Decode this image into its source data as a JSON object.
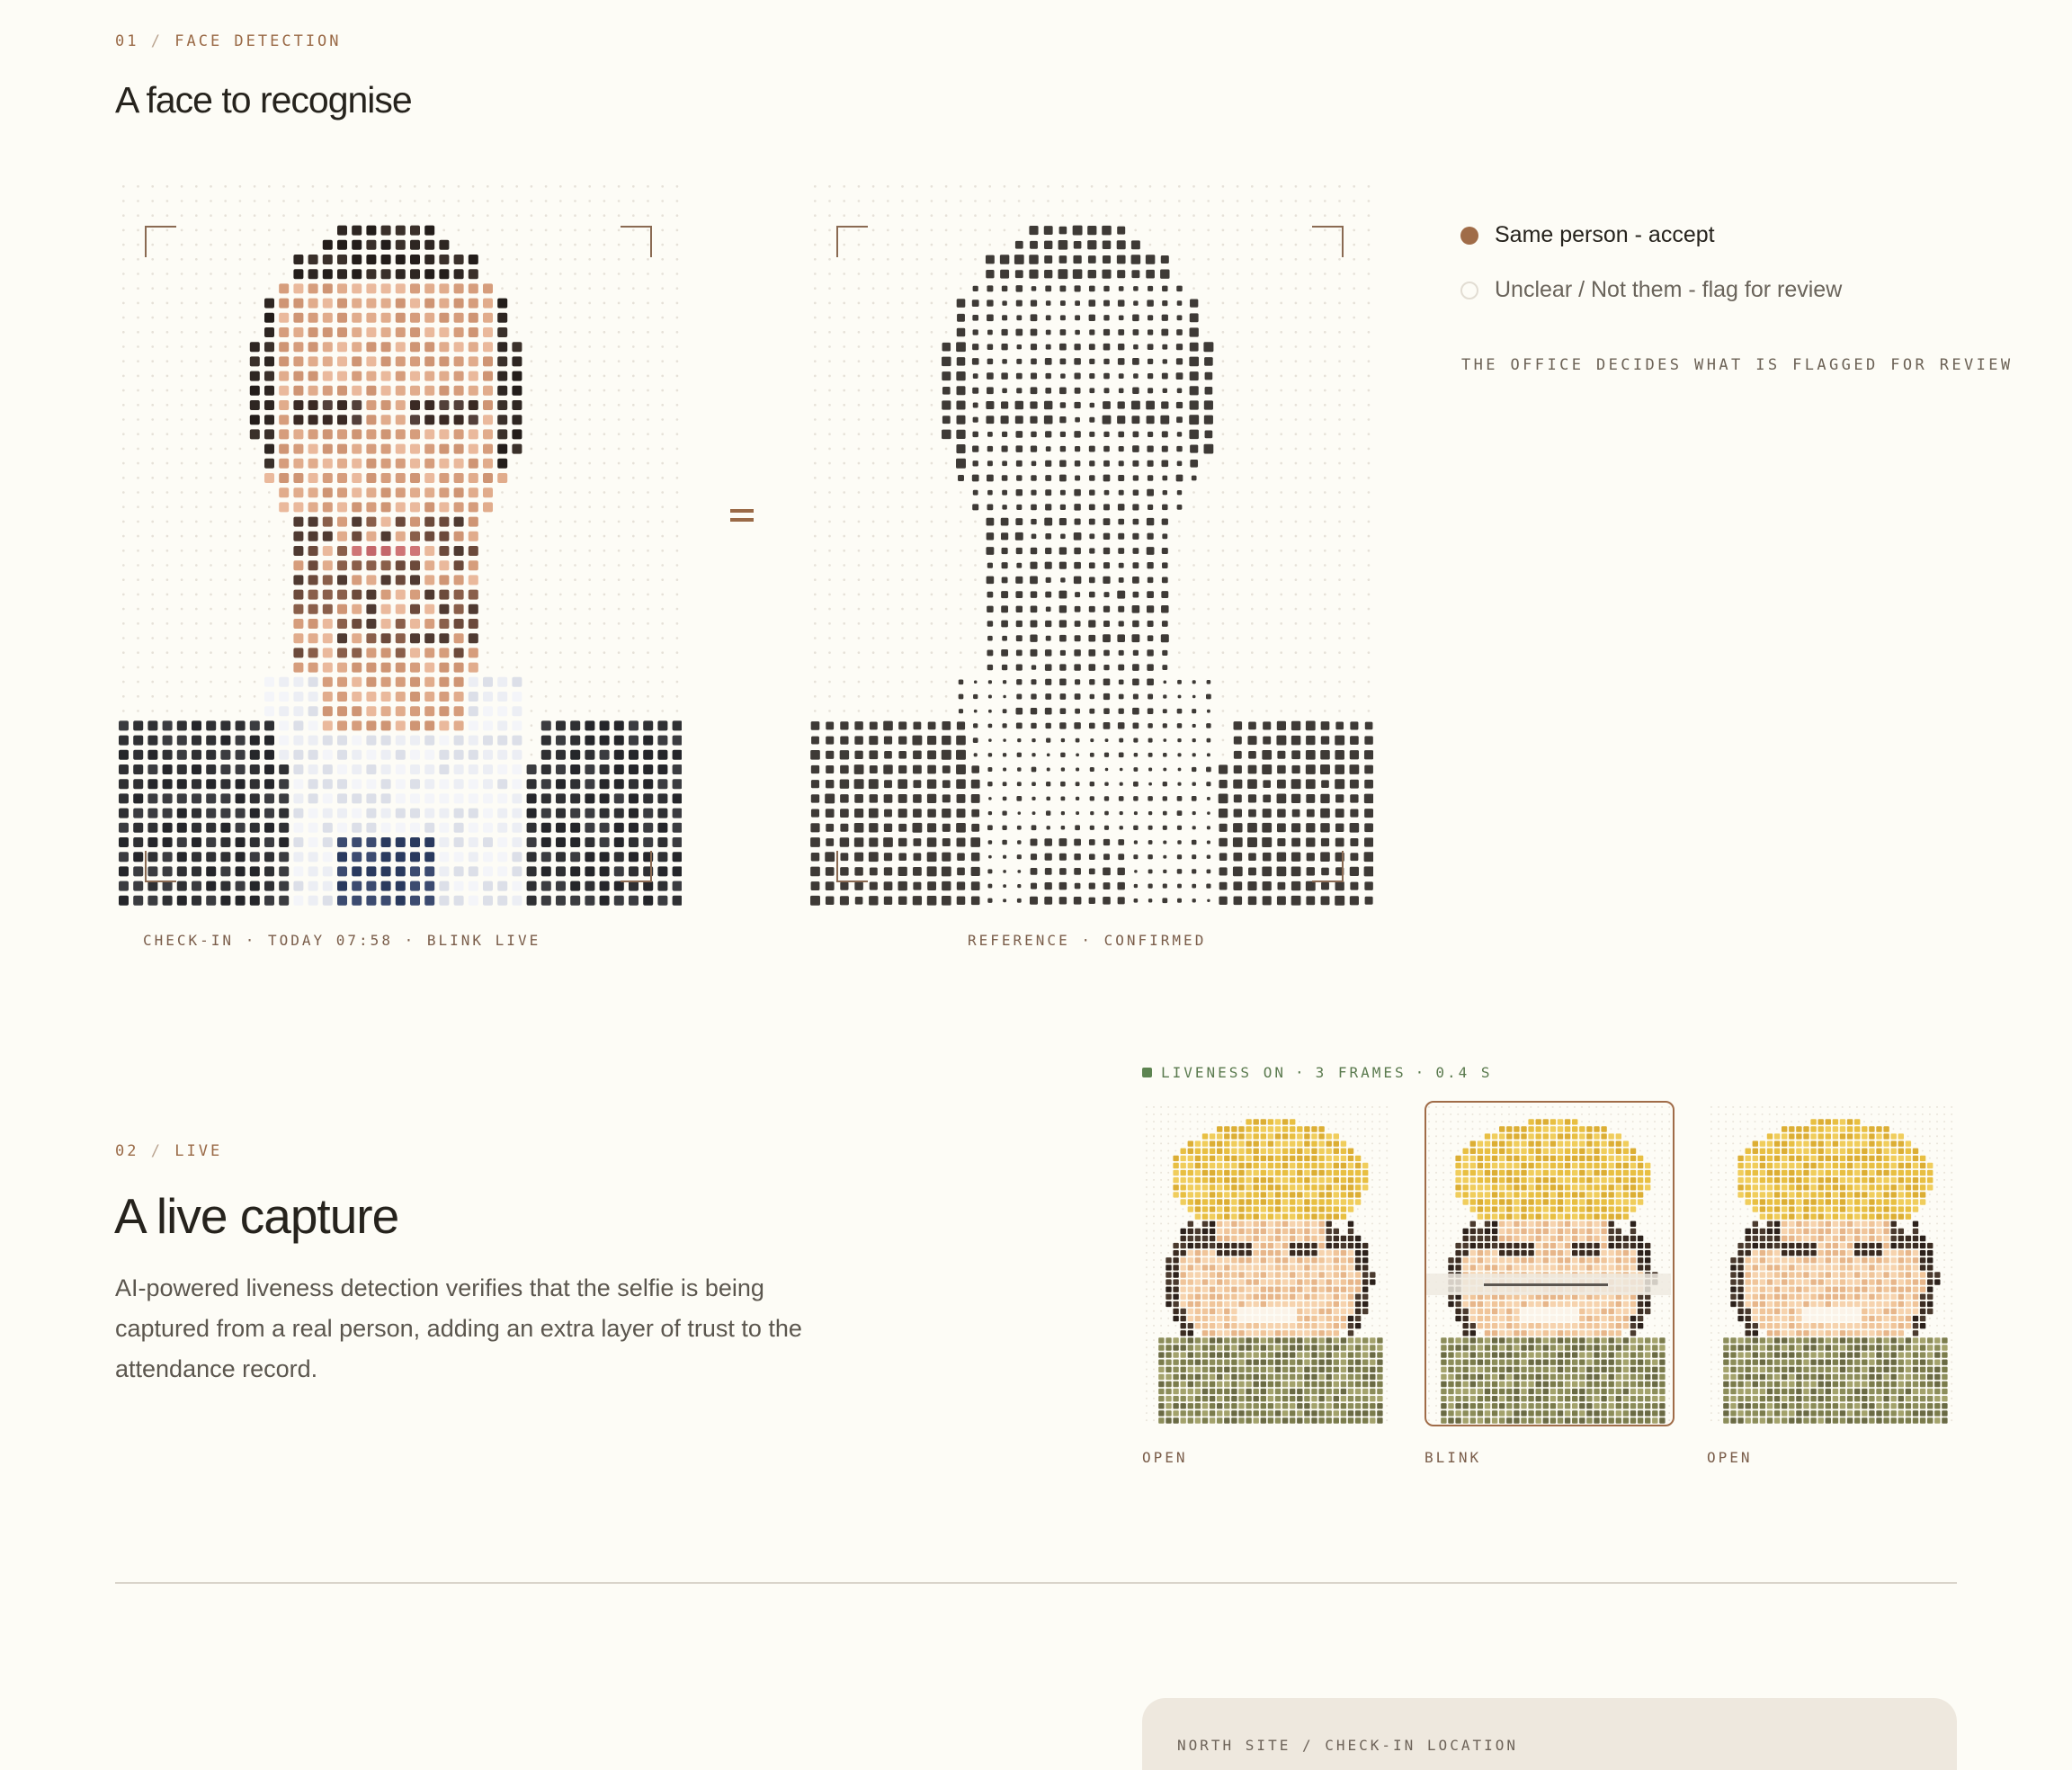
{
  "section1": {
    "number": "01",
    "slash": "/",
    "label": "FACE DETECTION",
    "title": "A face to recognise"
  },
  "checkin": {
    "caption_parts": [
      "CHECK-IN",
      "·",
      "TODAY 07:58",
      "·",
      "BLINK LIVE"
    ]
  },
  "equals_symbol": "equals-icon",
  "reference": {
    "caption_parts": [
      "REFERENCE",
      "·",
      "CONFIRMED"
    ]
  },
  "decision": {
    "options": [
      {
        "label": "Same person - accept",
        "selected": true
      },
      {
        "label": "Unclear / Not them - flag for review",
        "selected": false
      }
    ],
    "note": "THE OFFICE DECIDES WHAT IS FLAGGED FOR REVIEW"
  },
  "section2": {
    "number": "02",
    "slash": "/",
    "label": "LIVE",
    "title": "A live capture",
    "body": "AI-powered liveness detection verifies that the selfie is being captured from a real person, adding an extra layer of trust to the attendance record."
  },
  "liveness": {
    "header_parts": [
      "LIVENESS ON",
      "·",
      "3 FRAMES",
      "·",
      "0.4 S"
    ],
    "frames": [
      {
        "label": "OPEN",
        "selected": false
      },
      {
        "label": "BLINK",
        "selected": true
      },
      {
        "label": "OPEN",
        "selected": false
      }
    ]
  },
  "location": {
    "label": "NORTH SITE / CHECK-IN LOCATION"
  },
  "colors": {
    "accent": "#a06c48",
    "background": "#fdfcf6",
    "live_green": "#5d8451",
    "card": "#eee8de"
  }
}
